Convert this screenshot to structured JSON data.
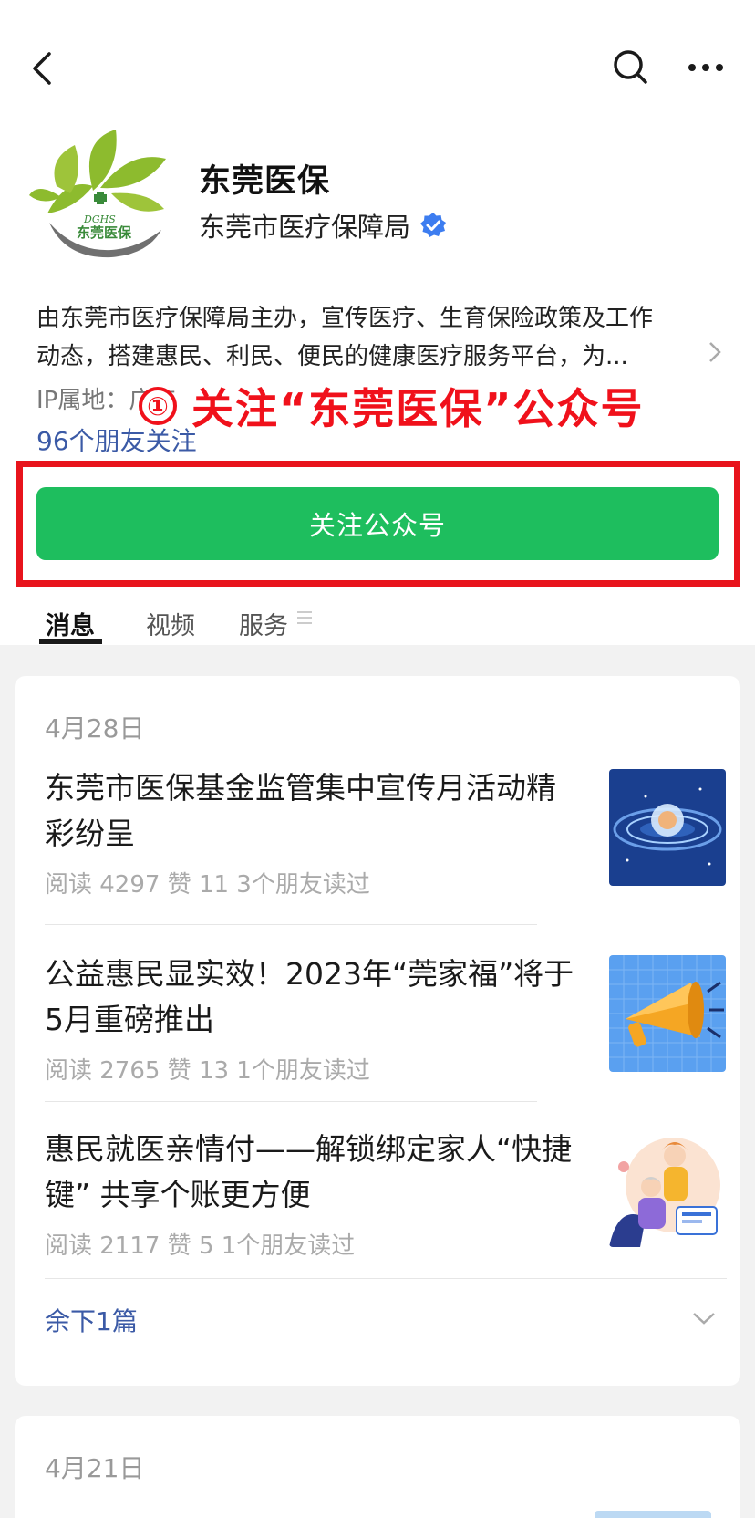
{
  "account": {
    "name": "东莞医保",
    "org": "东莞市医疗保障局",
    "logo_text_latin": "DGHS",
    "logo_text_cn": "东莞医保",
    "description_lines": [
      "由东莞市医疗保障局主办，宣传医疗、生育保险政策及工作",
      "动态，搭建惠民、利民、便民的健康医疗服务平台，为..."
    ],
    "ip_label": "IP属地：广东",
    "friends": "96个朋友关注",
    "follow_button": "关注公众号"
  },
  "annotation": {
    "number": "①",
    "text": "关注“东莞医保”公众号",
    "color": "#f0111b"
  },
  "tabs": [
    {
      "label": "消息",
      "active": true
    },
    {
      "label": "视频",
      "active": false
    },
    {
      "label": "服务",
      "active": false
    }
  ],
  "groups": [
    {
      "date": "4月28日",
      "articles": [
        {
          "title": "东莞市医保基金监管集中宣传月活动精彩纷呈",
          "meta": "阅读 4297   赞 11   3个朋友读过",
          "thumb": "galaxy-thumbnail"
        },
        {
          "title": "公益惠民显实效！2023年“莞家福”将于5月重磅推出",
          "meta": "阅读 2765   赞 13   1个朋友读过",
          "thumb": "megaphone-thumbnail"
        },
        {
          "title": "惠民就医亲情付——解锁绑定家人“快捷键” 共享个账更方便",
          "meta": "阅读 2117   赞 5   1个朋友读过",
          "thumb": "family-thumbnail"
        }
      ],
      "more": "余下1篇"
    },
    {
      "date": "4月21日"
    }
  ],
  "colors": {
    "accent_green": "#1ebe5e",
    "link_blue": "#3b5aa6",
    "highlight_red": "#e8141c"
  }
}
